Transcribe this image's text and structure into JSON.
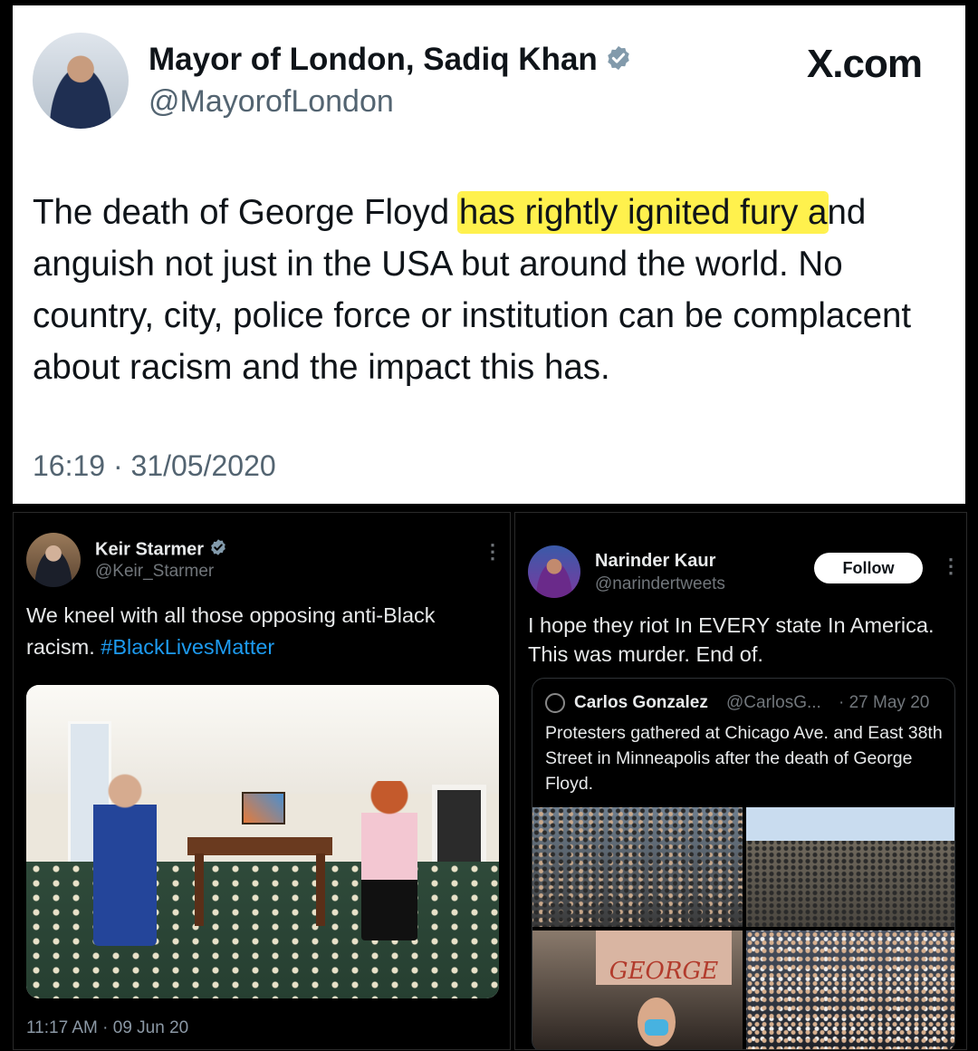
{
  "top_tweet": {
    "author_name": "Mayor of London, Sadiq Khan",
    "handle": "@MayorofLondon",
    "brand": "X.com",
    "text_before": "The death of George Floy",
    "text_d": "d ",
    "text_highlight": "has rightly ignited fury a",
    "text_after": "nd anguish not just in the USA but around the world. No country, city, police force or institution can be complacent about racism and the impact this has.",
    "timestamp": "16:19 · 31/05/2020",
    "highlight_color": "#fff14d"
  },
  "left_tweet": {
    "author_name": "Keir Starmer",
    "handle": "@Keir_Starmer",
    "text": "We kneel with all those opposing anti-Black racism. ",
    "hashtag": "#BlackLivesMatter",
    "timestamp": "11:17 AM · 09 Jun 20",
    "hashtag_color": "#1d9bf0"
  },
  "right_tweet": {
    "author_name": "Narinder Kaur",
    "handle": "@narindertweets",
    "follow_label": "Follow",
    "text": "I hope they riot In EVERY state In America. This was murder. End of.",
    "quote": {
      "author_name": "Carlos Gonzalez",
      "handle": "@CarlosG...",
      "date": "· 27 May 20",
      "text": "Protesters gathered at Chicago Ave. and East 38th Street in Minneapolis after the death of George Floyd.",
      "sign_text": "GEORGE"
    }
  }
}
